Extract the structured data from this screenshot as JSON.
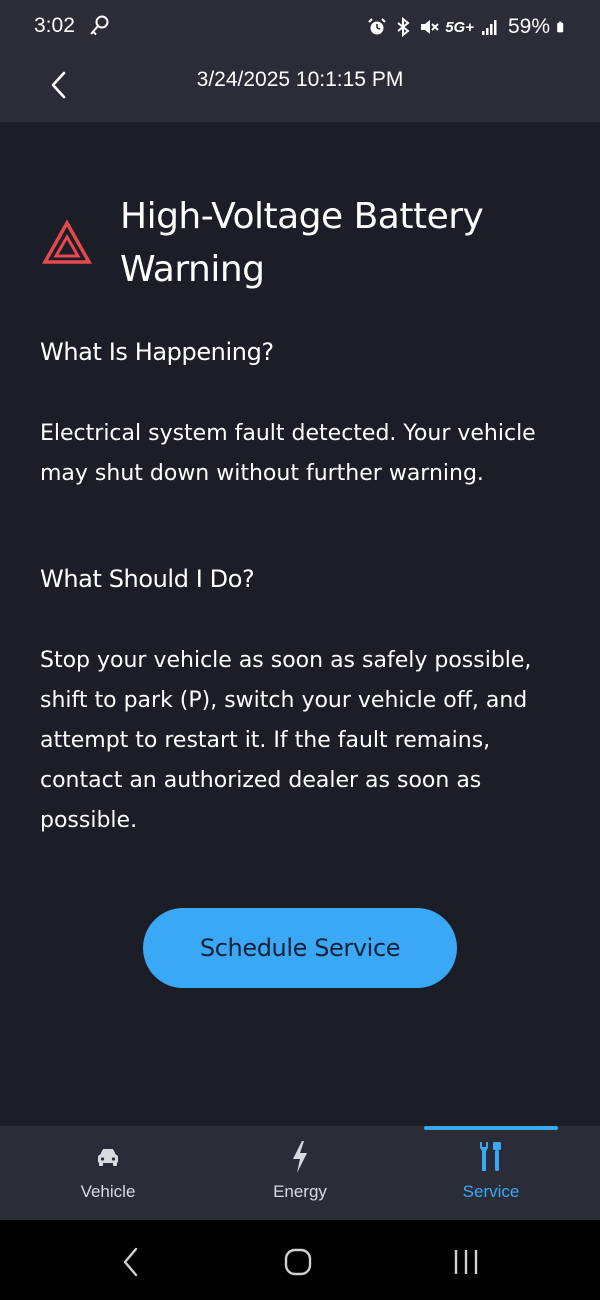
{
  "status_bar": {
    "time": "3:02",
    "network": "5G+",
    "battery": "59%",
    "icons": [
      "key-icon",
      "alarm-icon",
      "bluetooth-icon",
      "mute-icon",
      "signal-icon",
      "battery-icon"
    ]
  },
  "header": {
    "title": "3/24/2025 10:1:15 PM",
    "back_icon": "chevron-left-icon"
  },
  "alert": {
    "icon": "hazard-triangle-icon",
    "title": "High-Voltage Battery Warning",
    "sections": [
      {
        "heading": "What Is Happening?",
        "body": "Electrical system fault detected. Your vehicle may shut down without further warning."
      },
      {
        "heading": "What Should I Do?",
        "body": "Stop your vehicle as soon as safely possible, shift to park (P), switch your vehicle off, and attempt to restart it. If the fault remains, contact an authorized dealer as soon as possible."
      }
    ]
  },
  "actions": {
    "schedule_label": "Schedule Service"
  },
  "bottom_nav": {
    "items": [
      {
        "label": "Vehicle",
        "icon": "car-icon",
        "active": false
      },
      {
        "label": "Energy",
        "icon": "lightning-icon",
        "active": false
      },
      {
        "label": "Service",
        "icon": "tools-icon",
        "active": true
      }
    ]
  },
  "colors": {
    "background": "#1b1e27",
    "header": "#2a2d37",
    "accent": "#3ba8f5",
    "warning": "#e5484d"
  },
  "system_nav": {
    "icons": [
      "back-icon",
      "home-icon",
      "recents-icon"
    ]
  }
}
